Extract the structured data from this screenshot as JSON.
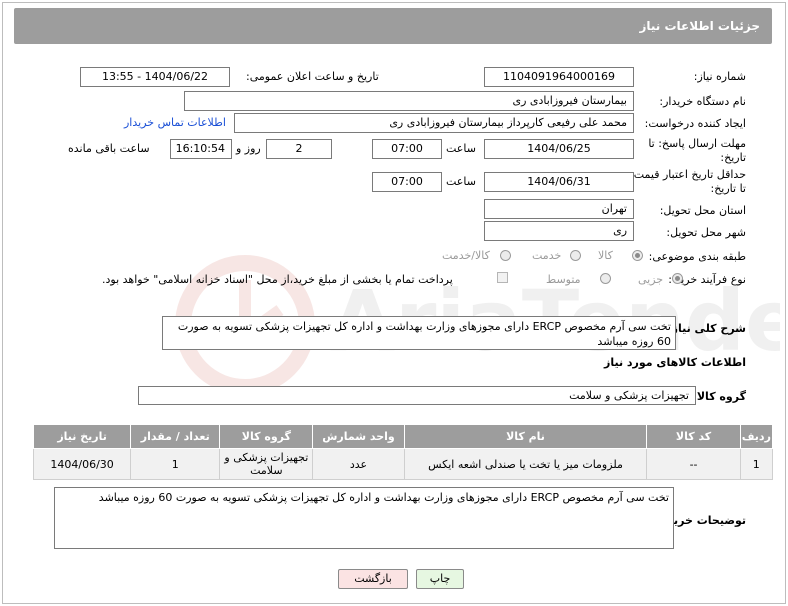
{
  "header": {
    "title": "جزئیات اطلاعات نیاز"
  },
  "fields": {
    "need_number_label": "شماره نیاز:",
    "need_number": "1104091964000169",
    "announce_label": "تاریخ و ساعت اعلان عمومی:",
    "announce_value": "1404/06/22 - 13:55",
    "buyer_org_label": "نام دستگاه خریدار:",
    "buyer_org": "بیمارستان فیروزابادی ری",
    "requester_label": "ایجاد کننده درخواست:",
    "requester": "محمد علی رفیعی کارپرداز بیمارستان فیروزابادی ری",
    "contact_link": "اطلاعات تماس خریدار",
    "deadline_label": "مهلت ارسال پاسخ: تا تاریخ:",
    "deadline_date": "1404/06/25",
    "time_label": "ساعت",
    "deadline_time": "07:00",
    "days_value": "2",
    "days_label": "روز و",
    "remaining_time": "16:10:54",
    "remaining_label": "ساعت باقی مانده",
    "price_validity_label": "حداقل تاریخ اعتبار قیمت: تا تاریخ:",
    "price_validity_date": "1404/06/31",
    "price_validity_time": "07:00",
    "province_label": "استان محل تحویل:",
    "province": "تهران",
    "city_label": "شهر محل تحویل:",
    "city": "ری",
    "category_label": "طبقه بندی موضوعی:",
    "category_options": [
      "کالا",
      "خدمت",
      "کالا/خدمت"
    ],
    "process_label": "نوع فرآیند خرید :",
    "process_options": [
      "جزیی",
      "متوسط"
    ],
    "payment_note": "پرداخت تمام یا بخشی از مبلغ خرید،از محل \"اسناد خزانه اسلامی\" خواهد بود."
  },
  "summary": {
    "label": "شرح کلی نیاز:",
    "text": "تخت سی آرم مخصوص ERCP دارای مجوزهای وزارت بهداشت و اداره کل تجهیزات پزشکی تسویه به صورت 60 روزه میباشد"
  },
  "goods": {
    "section_title": "اطلاعات کالاهای مورد نیاز",
    "group_label": "گروه کالا:",
    "group_value": "تجهیزات پزشکی و سلامت",
    "columns": [
      "ردیف",
      "کد کالا",
      "نام کالا",
      "واحد شمارش",
      "گروه کالا",
      "تعداد / مقدار",
      "تاریخ نیاز"
    ],
    "rows": [
      {
        "row": "1",
        "code": "--",
        "name": "ملزومات میز یا تخت یا صندلی اشعه ایکس",
        "unit": "عدد",
        "group": "تجهیزات پزشکی و سلامت",
        "qty": "1",
        "date": "1404/06/30"
      }
    ]
  },
  "buyer_notes": {
    "label": "توضیحات خریدار:",
    "text": "تخت سی آرم مخصوص ERCP دارای مجوزهای وزارت بهداشت و اداره کل تجهیزات پزشکی تسویه به صورت 60 روزه میباشد"
  },
  "buttons": {
    "print": "چاپ",
    "back": "بازگشت"
  },
  "colors": {
    "header_bg": "#9d9d9d",
    "link": "#1a4fd6",
    "back_btn_bg": "#fbe3e3",
    "print_btn_bg": "#e6f7e1"
  }
}
